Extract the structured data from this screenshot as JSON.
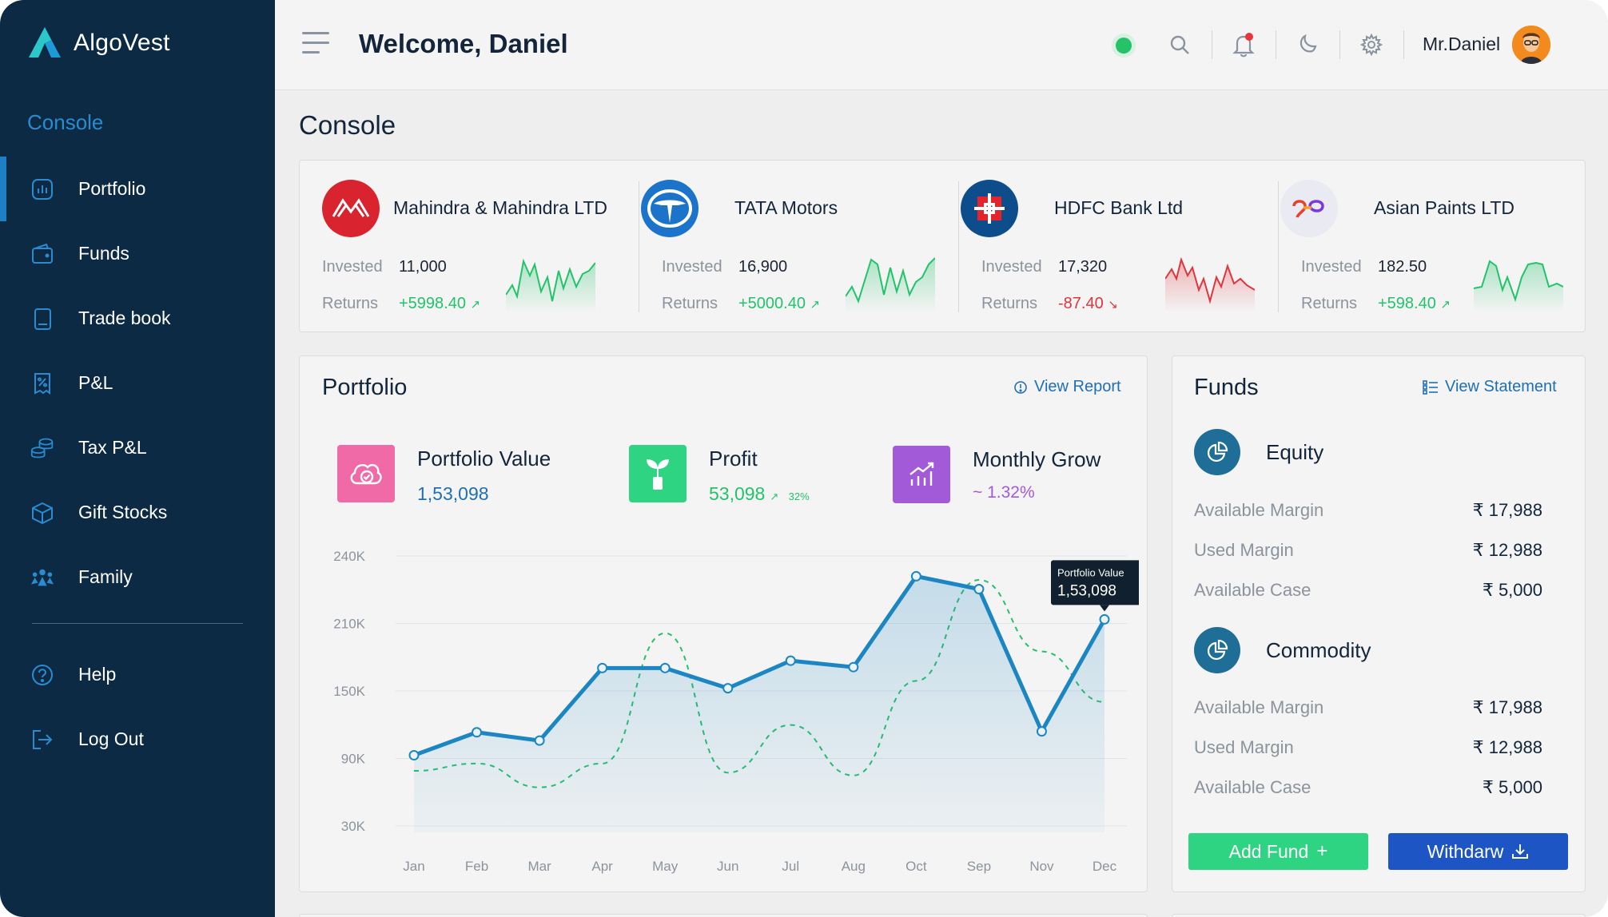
{
  "app": {
    "name": "AlgoVest"
  },
  "sidebar": {
    "section": "Console",
    "items": [
      {
        "label": "Portfolio",
        "icon": "bar-chart-icon",
        "active": true
      },
      {
        "label": "Funds",
        "icon": "wallet-icon"
      },
      {
        "label": "Trade book",
        "icon": "book-icon"
      },
      {
        "label": "P&L",
        "icon": "percent-receipt-icon"
      },
      {
        "label": "Tax P&L",
        "icon": "coins-icon"
      },
      {
        "label": "Gift Stocks",
        "icon": "box-icon"
      },
      {
        "label": "Family",
        "icon": "family-icon"
      }
    ],
    "bottom": [
      {
        "label": "Help",
        "icon": "help-icon"
      },
      {
        "label": "Log Out",
        "icon": "logout-icon"
      }
    ]
  },
  "header": {
    "welcome": "Welcome, Daniel",
    "user": "Mr.Daniel",
    "status": "online"
  },
  "page": {
    "title": "Console"
  },
  "stocks": [
    {
      "name": "Mahindra & Mahindra LTD",
      "invested_label": "Invested",
      "invested": "11,000",
      "returns_label": "Returns",
      "returns": "+5998.40",
      "trend": "up"
    },
    {
      "name": "TATA Motors",
      "invested_label": "Invested",
      "invested": "16,900",
      "returns_label": "Returns",
      "returns": "+5000.40",
      "trend": "up"
    },
    {
      "name": "HDFC Bank Ltd",
      "invested_label": "Invested",
      "invested": "17,320",
      "returns_label": "Returns",
      "returns": "-87.40",
      "trend": "down"
    },
    {
      "name": "Asian Paints LTD",
      "invested_label": "Invested",
      "invested": "182.50",
      "returns_label": "Returns",
      "returns": "+598.40",
      "trend": "up"
    }
  ],
  "portfolio": {
    "title": "Portfolio",
    "link": "View Report",
    "kpis": [
      {
        "label": "Portfolio Value",
        "value": "1,53,098",
        "sub": ""
      },
      {
        "label": "Profit",
        "value": "53,098",
        "sub": "32%"
      },
      {
        "label": "Monthly Grow",
        "value": "~ 1.32%",
        "sub": ""
      }
    ],
    "tooltip": {
      "label": "Portfolio Value",
      "value": "1,53,098"
    }
  },
  "chart_data": {
    "type": "line",
    "categories": [
      "Jan",
      "Feb",
      "Mar",
      "Apr",
      "May",
      "Jun",
      "Jul",
      "Aug",
      "Oct",
      "Sep",
      "Nov",
      "Dec"
    ],
    "y_ticks": [
      "240K",
      "210K",
      "150K",
      "90K",
      "30K"
    ],
    "series": [
      {
        "name": "Portfolio Value",
        "style": "solid-area",
        "color": "#1b86c2",
        "values": [
          77,
          102,
          93,
          172,
          172,
          150,
          180,
          173,
          272,
          258,
          103,
          225
        ]
      },
      {
        "style": "dashed",
        "color": "#27c06b",
        "values": [
          60,
          68,
          42,
          68,
          210,
          58,
          110,
          55,
          158,
          268,
          190,
          135
        ]
      }
    ],
    "grid": true,
    "highlight_index": 11
  },
  "funds": {
    "title": "Funds",
    "link": "View Statement",
    "groups": [
      {
        "name": "Equity",
        "rows": [
          {
            "label": "Available Margin",
            "amount": "₹ 17,988"
          },
          {
            "label": "Used Margin",
            "amount": "₹ 12,988"
          },
          {
            "label": "Available Case",
            "amount": "₹ 5,000"
          }
        ]
      },
      {
        "name": "Commodity",
        "rows": [
          {
            "label": "Available Margin",
            "amount": "₹ 17,988"
          },
          {
            "label": "Used Margin",
            "amount": "₹ 12,988"
          },
          {
            "label": "Available Case",
            "amount": "₹ 5,000"
          }
        ]
      }
    ],
    "add_label": "Add Fund",
    "withdraw_label": "Withdarw"
  },
  "colors": {
    "sidebar": "#0c2a44",
    "accent": "#1e7fc4",
    "up": "#22c36a",
    "down": "#e0353d",
    "profit_icon": "#2fd483",
    "grow_icon": "#a25ad8",
    "value_icon": "#ef6aa6"
  }
}
